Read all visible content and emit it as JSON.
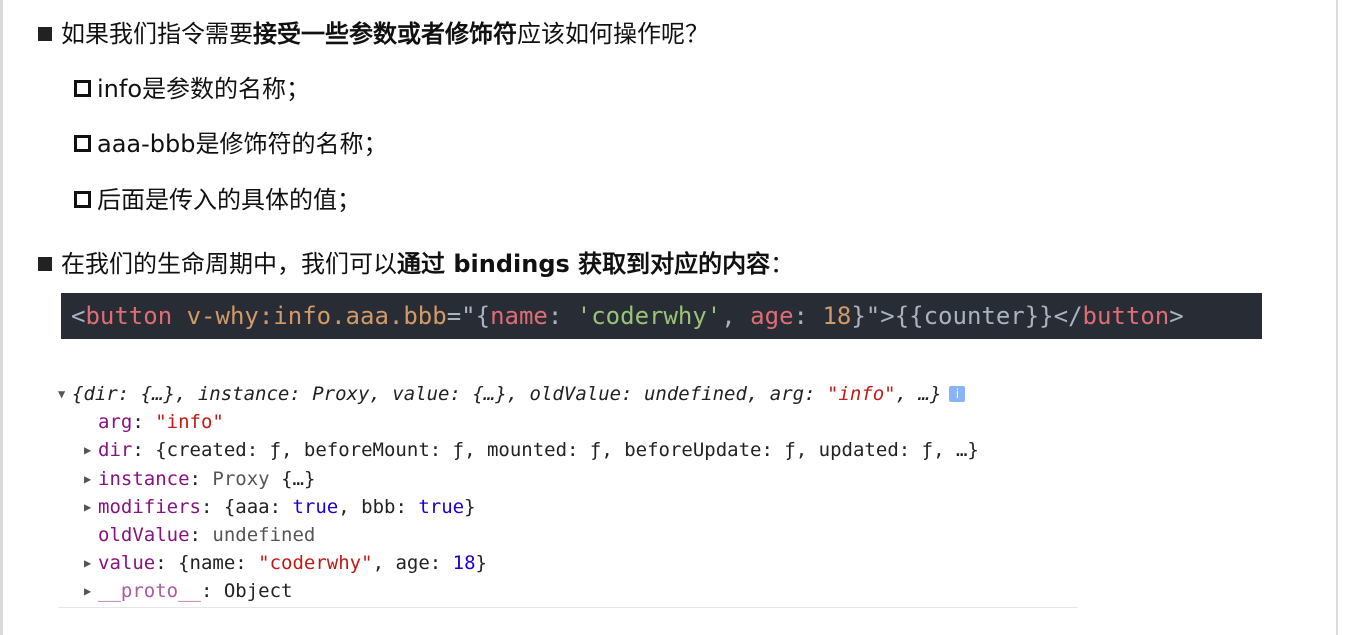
{
  "question": {
    "prefix": "如果我们指令需要",
    "bold": "接受一些参数或者修饰符",
    "suffix": "应该如何操作呢？"
  },
  "sub_items": [
    "info是参数的名称；",
    "aaa-bbb是修饰符的名称；",
    "后面是传入的具体的值；"
  ],
  "lifecycle": {
    "prefix": "在我们的生命周期中，我们可以",
    "bold": "通过 bindings 获取到对应的内容",
    "suffix": "："
  },
  "code": {
    "open_lt": "<",
    "tag_open": "button",
    "attr_name": "v-why:info.aaa.bbb",
    "eq_quote": "=\"{",
    "key1": "name",
    "colon_sp": ": ",
    "val1": "'coderwhy'",
    "comma_sp": ", ",
    "key2": "age",
    "val2": "18",
    "close_attr": "}\">{{counter}}</",
    "tag_close": "button",
    "close_gt": ">"
  },
  "console": {
    "summary": {
      "part1": "{dir: {…}, instance: Proxy, value: {…}, oldValue: undefined, arg: ",
      "arg_val": "\"info\"",
      "part2": ", …}",
      "info_glyph": "i"
    },
    "arg": {
      "key": "arg",
      "value": "\"info\""
    },
    "dir": {
      "key": "dir",
      "value": "{created: ƒ, beforeMount: ƒ, mounted: ƒ, beforeUpdate: ƒ, updated: ƒ, …}"
    },
    "instance": {
      "key": "instance",
      "proxy": "Proxy",
      "rest": "{…}"
    },
    "modifiers": {
      "key": "modifiers",
      "pre": "{aaa: ",
      "v1": "true",
      "mid": ", bbb: ",
      "v2": "true",
      "post": "}"
    },
    "oldValue": {
      "key": "oldValue",
      "value": "undefined"
    },
    "value": {
      "key": "value",
      "pre": "{name: ",
      "name_val": "\"coderwhy\"",
      "mid": ", age: ",
      "age_val": "18",
      "post": "}"
    },
    "proto": {
      "key": "__proto__",
      "value": "Object"
    },
    "sep": ": "
  },
  "icons": {
    "bullet_filled": "filled-square-bullet",
    "bullet_hollow": "hollow-square-bullet",
    "expand": "triangle-right",
    "collapse": "triangle-down",
    "info": "info-icon"
  },
  "colors": {
    "code_bg": "#282c34",
    "console_key": "#881280",
    "console_string": "#c41a16",
    "console_bool_num": "#1c00cf"
  }
}
